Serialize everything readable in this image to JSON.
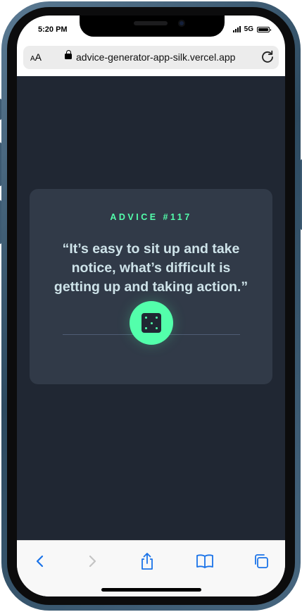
{
  "status_bar": {
    "time": "5:20 PM",
    "network": "5G"
  },
  "browser": {
    "text_size_label": "AA",
    "url": "advice-generator-app-silk.vercel.app"
  },
  "advice": {
    "id_label": "ADVICE #117",
    "quote": "“It’s easy to sit up and take notice, what’s difficult is getting up and taking action.”"
  },
  "colors": {
    "background": "#202733",
    "card": "#313a48",
    "accent": "#53ffab",
    "text": "#cee3e9"
  },
  "icons": {
    "dice": "dice-icon",
    "pause": "pause-icon",
    "back": "back-chevron-icon",
    "forward": "forward-chevron-icon",
    "share": "share-icon",
    "bookmarks": "book-icon",
    "tabs": "tabs-icon",
    "reload": "reload-icon",
    "lock": "lock-icon"
  }
}
